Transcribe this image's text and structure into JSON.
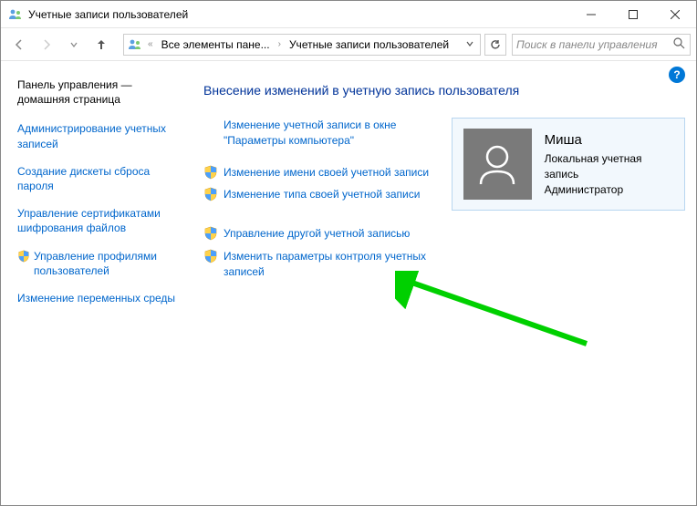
{
  "window": {
    "title": "Учетные записи пользователей"
  },
  "nav": {
    "breadcrumb_1": "Все элементы пане...",
    "breadcrumb_2": "Учетные записи пользователей",
    "search_placeholder": "Поиск в панели управления"
  },
  "sidebar": {
    "title": "Панель управления — домашняя страница",
    "links": [
      {
        "label": "Администрирование учетных записей",
        "shield": false
      },
      {
        "label": "Создание дискеты сброса пароля",
        "shield": false
      },
      {
        "label": "Управление сертификатами шифрования файлов",
        "shield": false
      },
      {
        "label": "Управление профилями пользователей",
        "shield": true
      },
      {
        "label": "Изменение переменных среды",
        "shield": false
      }
    ]
  },
  "main": {
    "heading": "Внесение изменений в учетную запись пользователя",
    "actions": [
      {
        "label": "Изменение учетной записи в окне \"Параметры компьютера\"",
        "shield": false,
        "indent": true
      },
      {
        "label": "Изменение имени своей учетной записи",
        "shield": true
      },
      {
        "label": "Изменение типа своей учетной записи",
        "shield": true
      },
      {
        "label": "Управление другой учетной записью",
        "shield": true,
        "gapbefore": true
      },
      {
        "label": "Изменить параметры контроля учетных записей",
        "shield": true
      }
    ]
  },
  "user": {
    "name": "Миша",
    "type": "Локальная учетная запись",
    "role": "Администратор"
  }
}
